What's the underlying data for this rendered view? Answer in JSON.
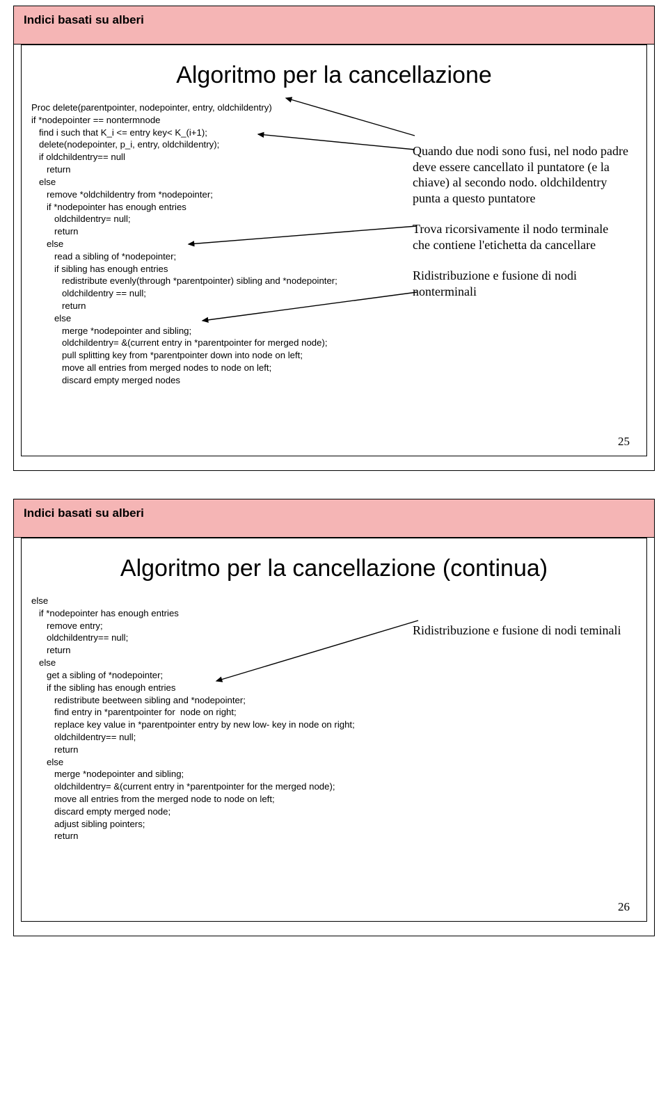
{
  "slide1": {
    "header": "Indici basati su alberi",
    "title": "Algoritmo per la cancellazione",
    "code": "Proc delete(parentpointer, nodepointer, entry, oldchildentry)\nif *nodepointer == nontermnode\n   find i such that K_i <= entry key< K_(i+1);\n   delete(nodepointer, p_i, entry, oldchildentry);\n   if oldchildentry== null\n      return\n   else\n      remove *oldchildentry from *nodepointer;\n      if *nodepointer has enough entries\n         oldchildentry= null;\n         return\n      else\n         read a sibling of *nodepointer;\n         if sibling has enough entries\n            redistribute evenly(through *parentpointer) sibling and *nodepointer;\n            oldchildentry == null;\n            return\n         else\n            merge *nodepointer and sibling;\n            oldchildentry= &(current entry in *parentpointer for merged node);\n            pull splitting key from *parentpointer down into node on left;\n            move all entries from merged nodes to node on left;\n            discard empty merged nodes",
    "anno1": "Quando due nodi sono fusi, nel nodo padre deve essere cancellato il puntatore (e la chiave) al secondo nodo. oldchildentry punta a questo puntatore",
    "anno2": "Trova ricorsivamente il nodo terminale che contiene l'etichetta da cancellare",
    "anno3": "Ridistribuzione e fusione di nodi nonterminali",
    "page": "25"
  },
  "slide2": {
    "header": "Indici basati su alberi",
    "title": "Algoritmo per la cancellazione (continua)",
    "code": "else\n   if *nodepointer has enough entries\n      remove entry;\n      oldchildentry== null;\n      return\n   else\n      get a sibling of *nodepointer;\n      if the sibling has enough entries\n         redistribute beetween sibling and *nodepointer;\n         find entry in *parentpointer for  node on right;\n         replace key value in *parentpointer entry by new low- key in node on right;\n         oldchildentry== null;\n         return\n      else\n         merge *nodepointer and sibling;\n         oldchildentry= &(current entry in *parentpointer for the merged node);\n         move all entries from the merged node to node on left;\n         discard empty merged node;\n         adjust sibling pointers;\n         return",
    "anno1": "Ridistribuzione e fusione di nodi teminali",
    "page": "26"
  }
}
